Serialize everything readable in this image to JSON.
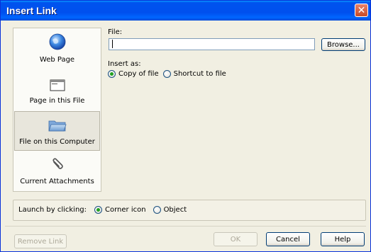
{
  "window": {
    "title": "Insert Link"
  },
  "sidebar": {
    "items": [
      {
        "label": "Web Page",
        "icon": "globe-icon",
        "selected": false
      },
      {
        "label": "Page in this File",
        "icon": "page-window-icon",
        "selected": false
      },
      {
        "label": "File on this Computer",
        "icon": "folder-icon",
        "selected": true
      },
      {
        "label": "Current Attachments",
        "icon": "paperclip-icon",
        "selected": false
      }
    ]
  },
  "file": {
    "label": "File:",
    "value": "",
    "browse_label": "Browse..."
  },
  "insert_as": {
    "label": "Insert as:",
    "options": [
      {
        "label": "Copy of file",
        "checked": true
      },
      {
        "label": "Shortcut to file",
        "checked": false
      }
    ]
  },
  "launch": {
    "label": "Launch by clicking:",
    "options": [
      {
        "label": "Corner icon",
        "checked": true
      },
      {
        "label": "Object",
        "checked": false
      }
    ]
  },
  "buttons": {
    "remove_link": "Remove Link",
    "ok": "OK",
    "cancel": "Cancel",
    "help": "Help"
  },
  "colors": {
    "title_bar": "#0053ee",
    "close_button": "#c74b26",
    "radio_checked": "#21a121"
  }
}
